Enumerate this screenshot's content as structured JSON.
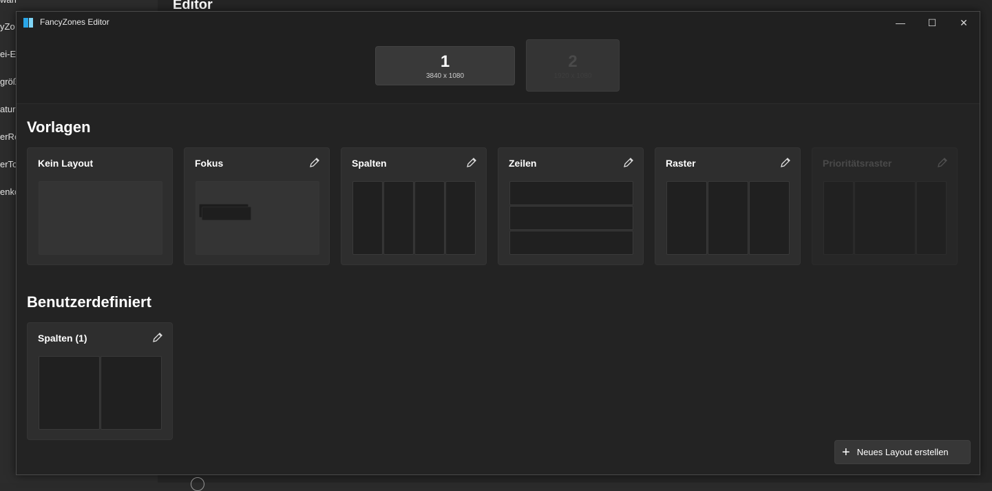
{
  "background": {
    "sidebar_items": [
      "wahler",
      "yZo",
      "ei-Ex",
      "größ",
      "atur",
      "erRe",
      "erTo",
      "enko"
    ],
    "page_title": "Editor"
  },
  "window": {
    "title": "FancyZones Editor",
    "minimize_glyph": "—",
    "maximize_glyph": "☐",
    "close_glyph": "✕"
  },
  "monitors": [
    {
      "number": "1",
      "resolution": "3840 x 1080"
    },
    {
      "number": "2",
      "resolution": "1920 x 1080"
    }
  ],
  "templates": {
    "title": "Vorlagen",
    "cards": [
      {
        "name": "Kein Layout"
      },
      {
        "name": "Fokus"
      },
      {
        "name": "Spalten"
      },
      {
        "name": "Zeilen"
      },
      {
        "name": "Raster"
      },
      {
        "name": "Prioritätsraster"
      }
    ]
  },
  "custom": {
    "title": "Benutzerdefiniert",
    "cards": [
      {
        "name": "Spalten (1)"
      }
    ]
  },
  "actions": {
    "new_layout_label": "Neues Layout erstellen",
    "new_layout_icon": "+"
  }
}
